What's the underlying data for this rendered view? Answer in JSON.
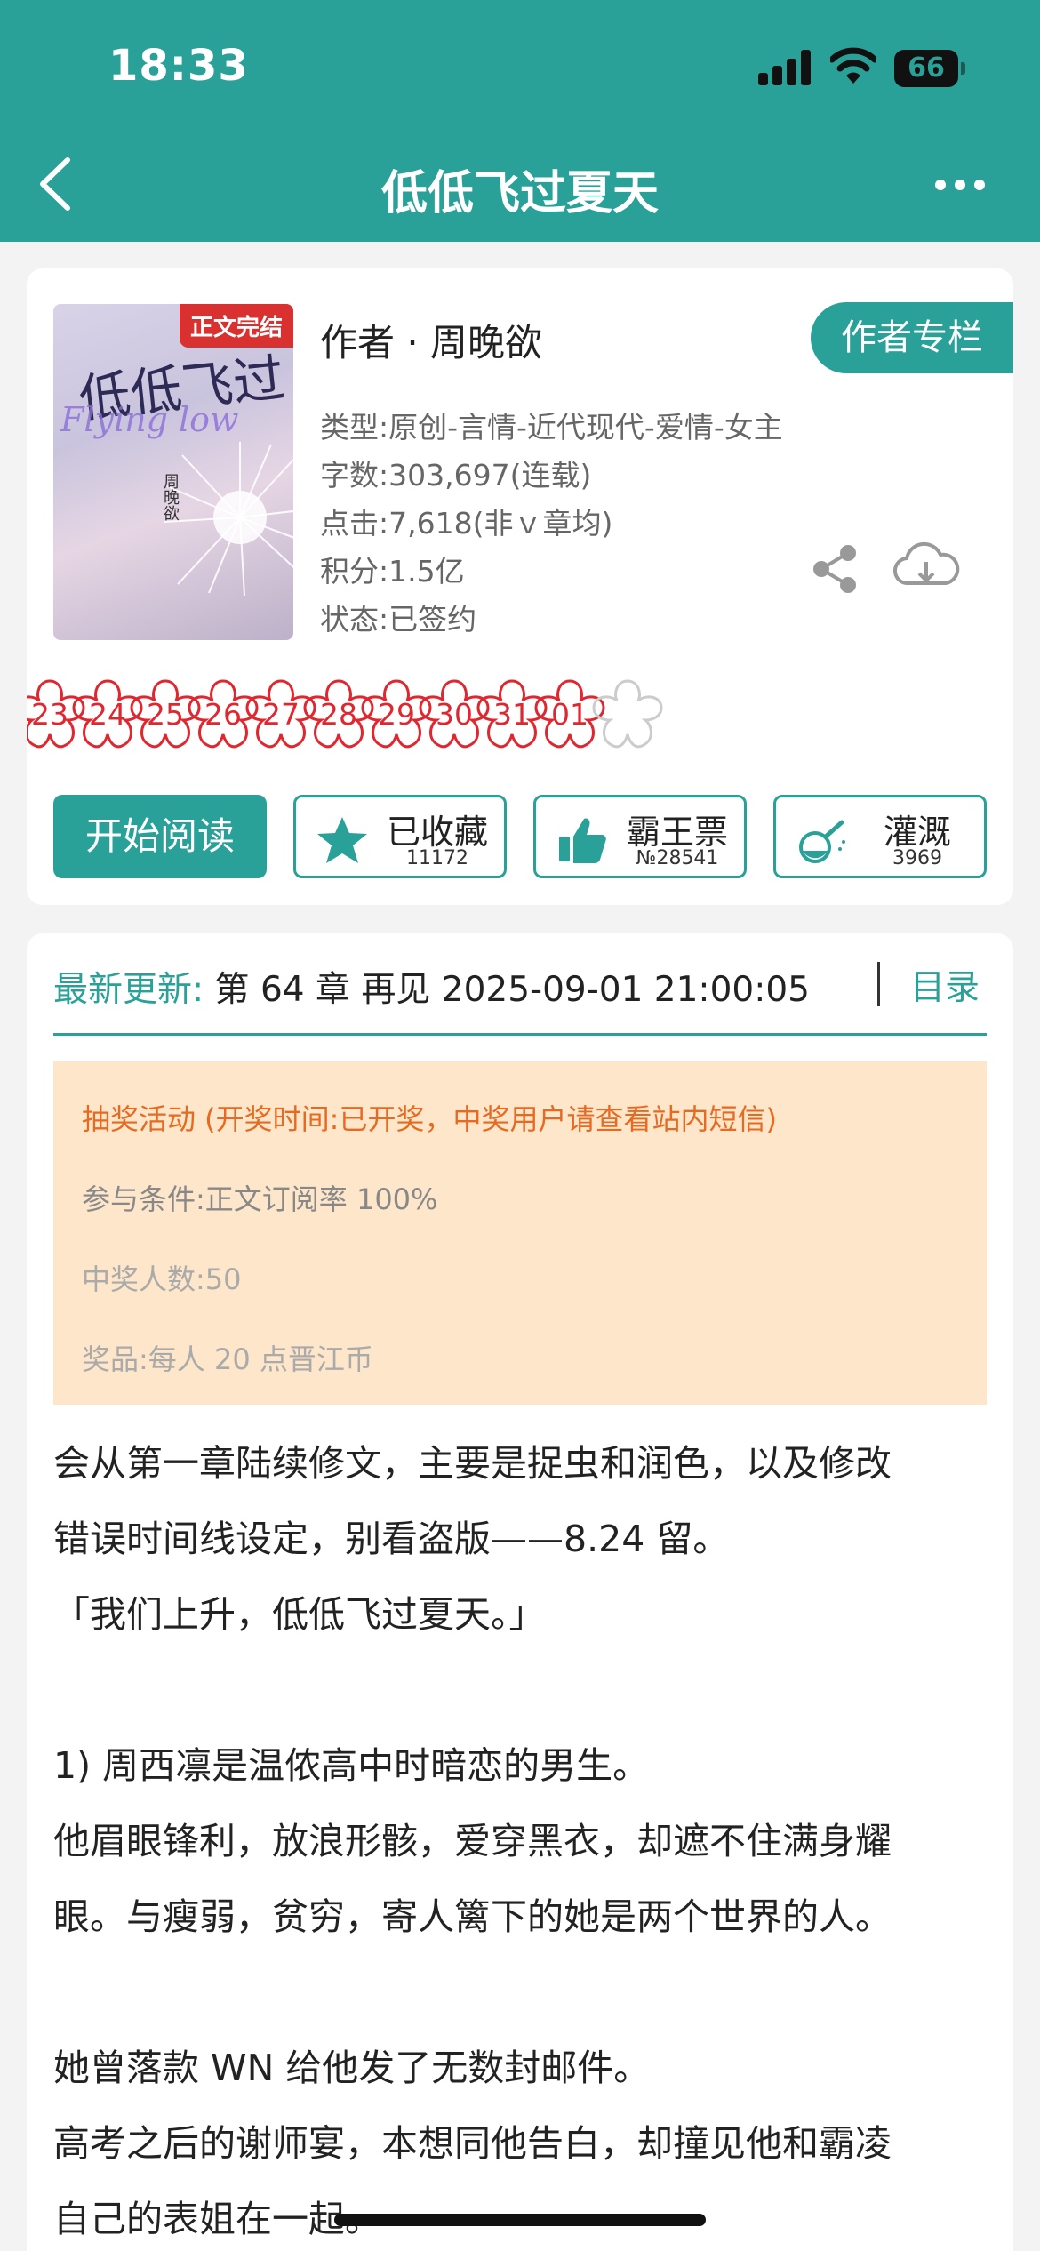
{
  "status": {
    "time": "18:33",
    "battery": "66"
  },
  "nav": {
    "title": "低低飞过夏天"
  },
  "book": {
    "cover_badge": "正文完结",
    "cover_title": "低低飞过",
    "cover_en": "Flying low",
    "cover_author": "周晚欲",
    "author": "作者 · 周晚欲",
    "author_column": "作者专栏",
    "meta": [
      "类型:原创-言情-近代现代-爱情-女主",
      "字数:303,697(连载)",
      "点击:7,618(非ｖ章均)",
      "积分:1.5亿",
      "状态:已签约"
    ]
  },
  "flowers": [
    "23",
    "24",
    "25",
    "26",
    "27",
    "28",
    "29",
    "30",
    "31",
    "01"
  ],
  "actions": {
    "start": "开始阅读",
    "collect": {
      "label": "已收藏",
      "count": "11172"
    },
    "vote": {
      "label": "霸王票",
      "count": "№28541"
    },
    "water": {
      "label": "灌溉",
      "count": "3969"
    }
  },
  "latest": {
    "label": "最新更新:",
    "text": "第 64 章 再见 2025-09-01 21:00:05",
    "toc": "目录"
  },
  "lottery": {
    "title": "抽奖活动 (开奖时间:已开奖，中奖用户请查看站内短信)",
    "condition": "参与条件:正文订阅率 100%",
    "winners": "中奖人数:50",
    "prize": "奖品:每人 20 点晋江币"
  },
  "description": [
    "会从第一章陆续修文，主要是捉虫和润色，以及修改",
    "错误时间线设定，别看盗版——8.24 留。",
    "「我们上升，低低飞过夏天。」",
    "1) 周西凛是温侬高中时暗恋的男生。",
    "他眉眼锋利，放浪形骸，爱穿黑衣，却遮不住满身耀",
    "眼。与瘦弱，贫穷，寄人篱下的她是两个世界的人。",
    "她曾落款 WN 给他发了无数封邮件。",
    "高考之后的谢师宴，本想同他告白，却撞见他和霸凌",
    "自己的表姐在一起。"
  ],
  "colors": {
    "accent": "#2aa198",
    "flower": "#e0262e",
    "lottery_bg": "#fde6c9",
    "lottery_title": "#e66a22"
  }
}
